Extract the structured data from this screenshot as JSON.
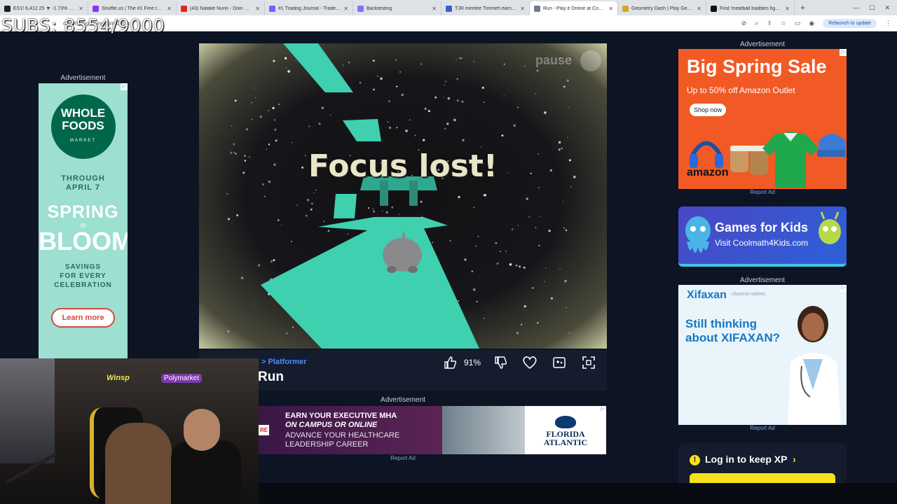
{
  "browser": {
    "tabs": [
      {
        "label": "ES1! 6,412.25 ▼ -1.73% MACR…",
        "fav_color": "#1e1e1e",
        "active": false
      },
      {
        "label": "Shuffle.us | The #1 Free to Play…",
        "fav_color": "#7d3cf0",
        "active": false
      },
      {
        "label": "(43) Natalie Nunn - Doin What…",
        "fav_color": "#e62117",
        "active": false
      },
      {
        "label": "#1 Trading Journal - TradeZella",
        "fav_color": "#7b5cff",
        "active": false
      },
      {
        "label": "Backtesting",
        "fav_color": "#8a6cff",
        "active": false
      },
      {
        "label": "TJR mentee Timmeh earns pro…",
        "fav_color": "#3b5fc9",
        "active": false
      },
      {
        "label": "Run - Play it Online at Coolmat…",
        "fav_color": "#6b7c93",
        "active": true
      },
      {
        "label": "Geometry Dash | Play Geometr…",
        "fav_color": "#d6a626",
        "active": false
      },
      {
        "label": "Find 'meatball baddies fight' on…",
        "fav_color": "#111111",
        "active": false
      }
    ],
    "new_tab": "+",
    "window_controls": [
      "—",
      "☐",
      "✕"
    ],
    "url": "coolmathgames.com/0-run",
    "relaunch": "Relaunch to update"
  },
  "overlay": {
    "subs": "SUBS: 8554/9000"
  },
  "ads": {
    "label": "Advertisement",
    "report": "Report Ad",
    "wholefoods": {
      "logo_line1": "WHOLE",
      "logo_line2": "FOODS",
      "logo_line3": "MARKET",
      "through1": "THROUGH",
      "through2": "APRIL 7",
      "spring": "SPRING",
      "in": "IN",
      "bloom": "BLOOM",
      "savings1": "SAVINGS",
      "savings2": "FOR EVERY",
      "savings3": "CELEBRATION",
      "cta": "Learn more"
    },
    "amazon": {
      "title": "Big Spring Sale",
      "sub": "Up to 50% off Amazon Outlet",
      "cta": "Shop now",
      "logo": "amazon"
    },
    "cm4k": {
      "title": "Games for Kids",
      "sub": "Visit Coolmath4Kids.com"
    },
    "xifaxan": {
      "logo": "Xifaxan",
      "tag": "rifaximin tablets",
      "question": "Still thinking about XIFAXAN?"
    },
    "fau": {
      "badge": "RE",
      "l1": "EARN YOUR EXECUTIVE MHA",
      "l2": "ON CAMPUS OR ONLINE",
      "l3": "ADVANCE YOUR HEALTHCARE",
      "l4": "LEADERSHIP CAREER",
      "name1": "FLORIDA",
      "name2": "ATLANTIC"
    }
  },
  "game": {
    "overlay_text": "Focus lost!",
    "pause_label": "pause",
    "breadcrumb": "> Platformer",
    "title": "Run",
    "like_pct": "91%",
    "tile_color": "#3fd0b0"
  },
  "xp": {
    "text": "Log in to keep XP",
    "chevron": "›",
    "icon": "!"
  },
  "webcam": {
    "sign1": "Winsp",
    "sign2": "Polymarket"
  }
}
